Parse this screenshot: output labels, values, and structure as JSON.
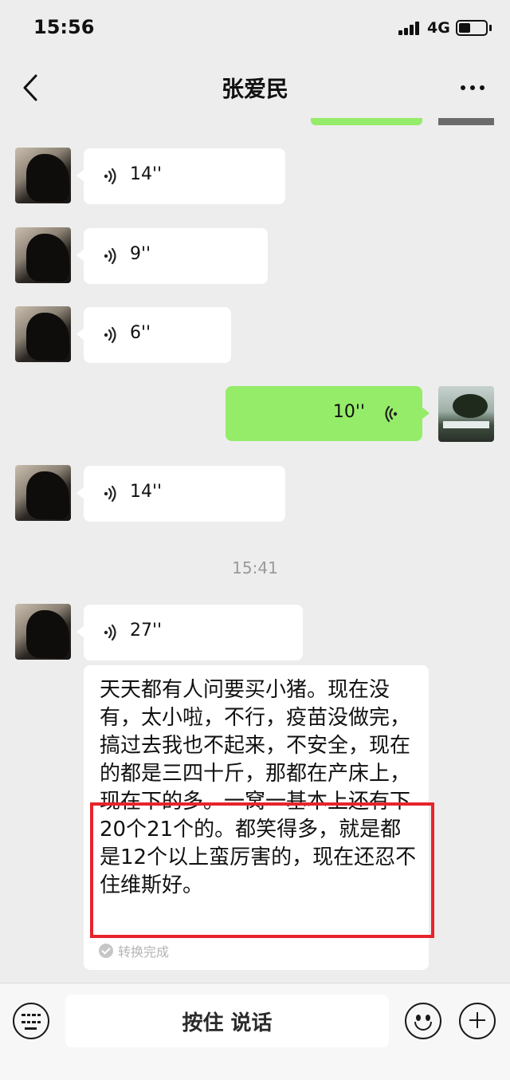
{
  "status_bar": {
    "time": "15:56",
    "network": "4G"
  },
  "nav": {
    "title": "张爱民"
  },
  "messages": [
    {
      "direction": "in",
      "duration": "14''"
    },
    {
      "direction": "in",
      "duration": "9''"
    },
    {
      "direction": "in",
      "duration": "6''"
    },
    {
      "direction": "out",
      "duration": "10''"
    },
    {
      "direction": "in",
      "duration": "14''"
    },
    {
      "direction": "in",
      "duration": "27''"
    }
  ],
  "timestamp": "15:41",
  "transcript": {
    "text": "天天都有人问要买小猪。现在没有，太小啦，不行，疫苗没做完，搞过去我也不起来，不安全，现在的都是三四十斤，那都在产床上，现在下的多。一窝一基本上还有下20个21个的。都笑得多，就是都是12个以上蛮厉害的，现在还忍不住维斯好。",
    "status": "转换完成"
  },
  "input_bar": {
    "hold_to_talk": "按住 说话"
  },
  "colors": {
    "outgoing_bubble": "#95ec69",
    "highlight": "#e7242b",
    "background": "#ededed"
  }
}
